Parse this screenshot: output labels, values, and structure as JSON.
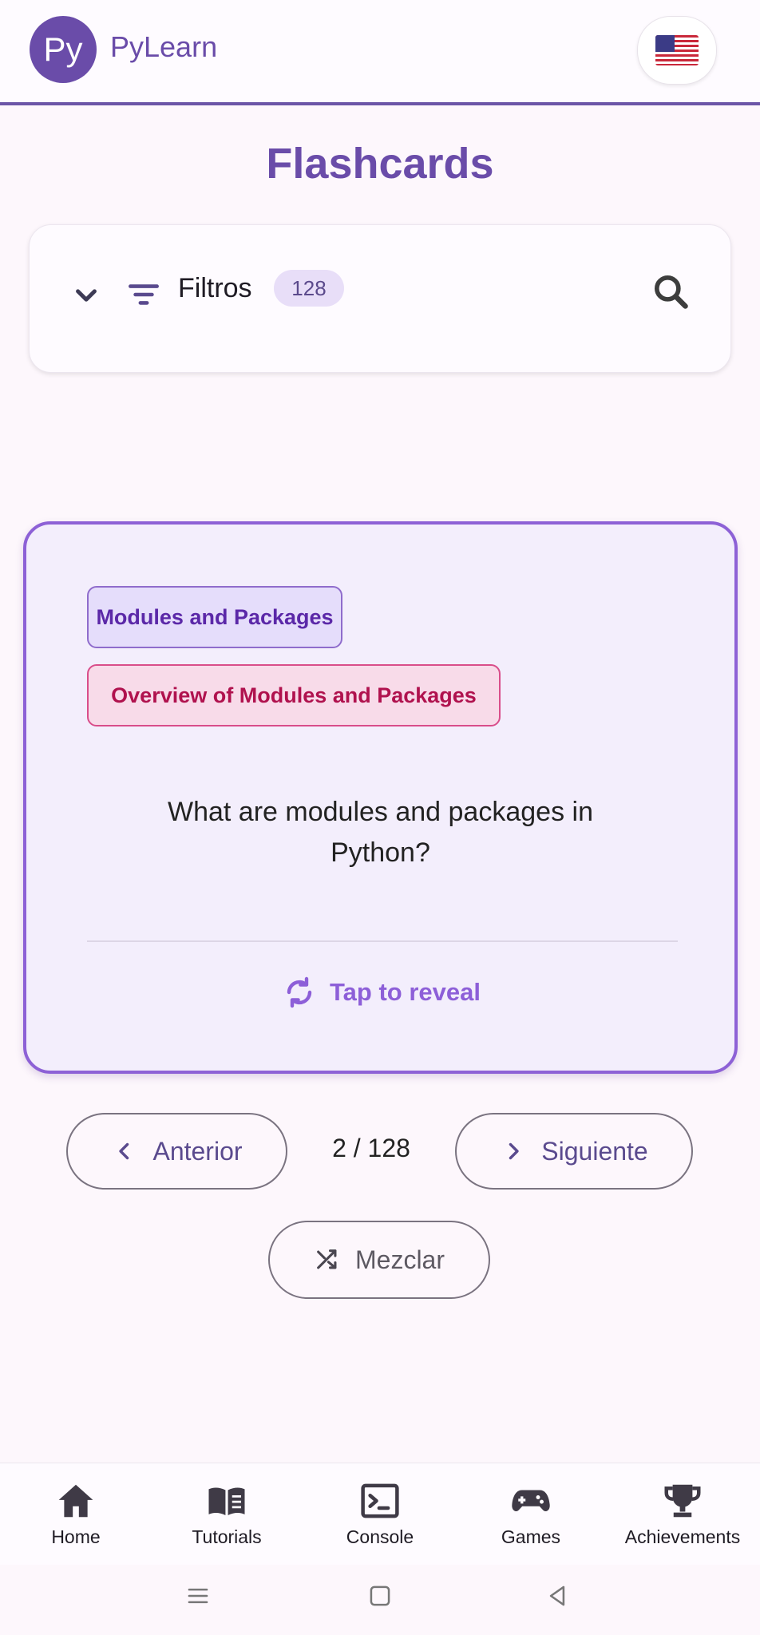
{
  "app": {
    "logo_text": "Py",
    "name": "PyLearn",
    "language_icon": "us-flag-icon"
  },
  "page": {
    "title": "Flashcards"
  },
  "filters": {
    "label": "Filtros",
    "count": "128",
    "icons": [
      "chevron-down-icon",
      "filter-icon",
      "search-icon"
    ]
  },
  "card": {
    "tags": [
      "Modules and Packages",
      "Overview of Modules and Packages"
    ],
    "question": "What are modules and packages in Python?",
    "reveal_label": "Tap to reveal"
  },
  "navigation": {
    "prev_label": "Anterior",
    "counter": "2 / 128",
    "next_label": "Siguiente",
    "shuffle_label": "Mezclar"
  },
  "bottom_nav": {
    "items": [
      {
        "label": "Home",
        "icon": "home-icon"
      },
      {
        "label": "Tutorials",
        "icon": "book-icon"
      },
      {
        "label": "Console",
        "icon": "terminal-icon"
      },
      {
        "label": "Games",
        "icon": "gamepad-icon"
      },
      {
        "label": "Achievements",
        "icon": "trophy-icon"
      }
    ]
  },
  "system_nav": [
    "menu-icon",
    "home-square-icon",
    "back-icon"
  ],
  "colors": {
    "primary": "#6a4ca9",
    "card_border": "#8d61d6",
    "tag_primary": "#5b28a8",
    "tag_secondary": "#b0124e",
    "background": "#fdf7fc"
  }
}
